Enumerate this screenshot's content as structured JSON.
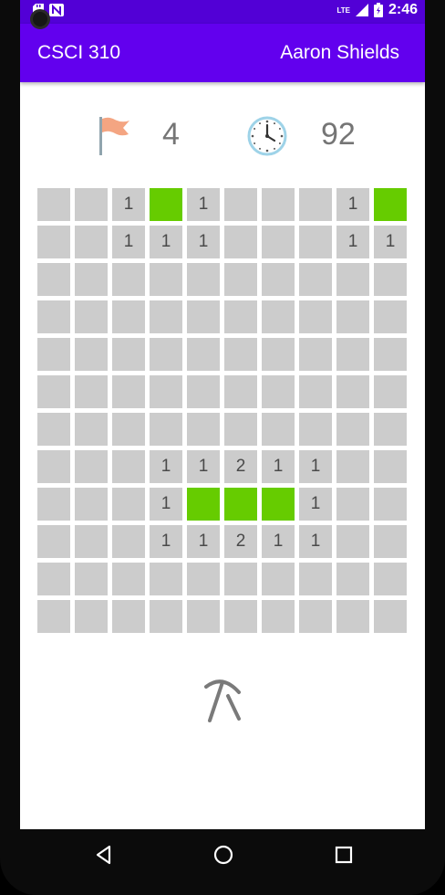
{
  "status_bar": {
    "time": "2:46",
    "network": "LTE",
    "icons": [
      "sd-card-icon",
      "n-icon",
      "signal-icon",
      "battery-charging-icon"
    ]
  },
  "app_bar": {
    "title": "CSCI 310",
    "author": "Aaron Shields",
    "color": "#6200ee"
  },
  "counters": {
    "flags": "4",
    "time": "92",
    "flag_icon": "flag-icon",
    "clock_icon": "clock-icon"
  },
  "board": {
    "rows": 12,
    "cols": 10,
    "cells": [
      [
        "",
        "",
        "1",
        "#",
        "1",
        "",
        "",
        "",
        "1",
        "#"
      ],
      [
        "",
        "",
        "1",
        "1",
        "1",
        "",
        "",
        "",
        "1",
        "1"
      ],
      [
        "",
        "",
        "",
        "",
        "",
        "",
        "",
        "",
        "",
        ""
      ],
      [
        "",
        "",
        "",
        "",
        "",
        "",
        "",
        "",
        "",
        ""
      ],
      [
        "",
        "",
        "",
        "",
        "",
        "",
        "",
        "",
        "",
        ""
      ],
      [
        "",
        "",
        "",
        "",
        "",
        "",
        "",
        "",
        "",
        ""
      ],
      [
        "",
        "",
        "",
        "",
        "",
        "",
        "",
        "",
        "",
        ""
      ],
      [
        "",
        "",
        "",
        "1",
        "1",
        "2",
        "1",
        "1",
        "",
        ""
      ],
      [
        "",
        "",
        "",
        "1",
        "#",
        "#",
        "#",
        "1",
        "",
        ""
      ],
      [
        "",
        "",
        "",
        "1",
        "1",
        "2",
        "1",
        "1",
        "",
        ""
      ],
      [
        "",
        "",
        "",
        "",
        "",
        "",
        "",
        "",
        "",
        ""
      ],
      [
        "",
        "",
        "",
        "",
        "",
        "",
        "",
        "",
        "",
        ""
      ]
    ],
    "colors": {
      "hidden": "#cccccc",
      "revealed_green": "#66cc00"
    }
  },
  "mode_toggle": {
    "icon": "pickaxe-icon"
  },
  "nav_bar": {
    "icons": [
      "back-icon",
      "home-icon",
      "recents-icon"
    ]
  }
}
